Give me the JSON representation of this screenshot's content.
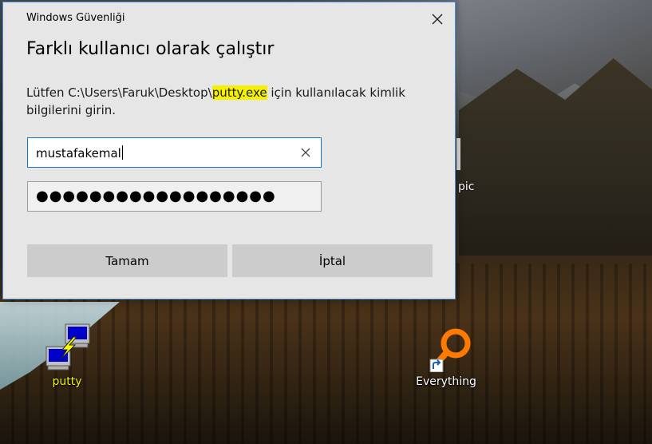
{
  "dialog": {
    "window_title": "Windows Güvenliği",
    "heading": "Farklı kullanıcı olarak çalıştır",
    "message_prefix": "Lütfen C:\\Users\\Faruk\\Desktop\\",
    "message_highlight": "putty.exe",
    "message_suffix": " için kullanılacak kimlik bilgilerini girin.",
    "username_value": "mustafakemal",
    "password_mask": "●●●●●●●●●●●●●●●●●●",
    "ok_label": "Tamam",
    "cancel_label": "İptal",
    "highlight_color": "#f4f000",
    "focus_border_color": "#1a73c8"
  },
  "desktop": {
    "icons": [
      {
        "label": "putty",
        "icon": "putty-icon"
      },
      {
        "label": "Everything",
        "icon": "everything-search-icon"
      }
    ],
    "partial_label": "pic"
  }
}
